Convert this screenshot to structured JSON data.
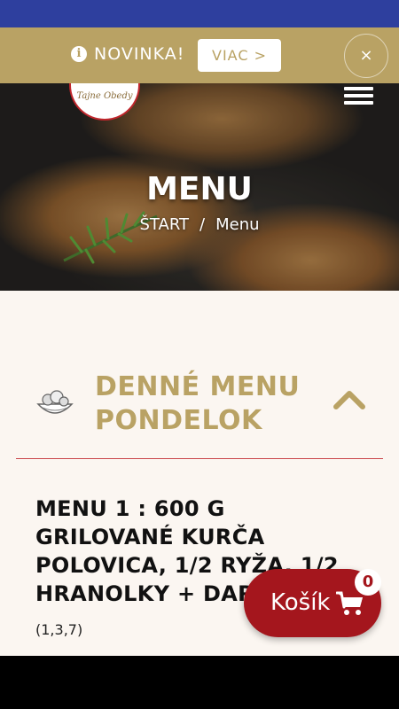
{
  "promo": {
    "info_icon": "info-icon",
    "info_glyph": "i",
    "text": "NOVINKA!",
    "button_label": "VIAC",
    "button_chevron": ">",
    "close_glyph": "×"
  },
  "header": {
    "logo_text": "Tajne Obedy",
    "menu_icon": "hamburger-icon"
  },
  "hero": {
    "title": "MENU",
    "breadcrumb": {
      "home": "ŠTART",
      "separator": "/",
      "current": "Menu"
    }
  },
  "accordion": {
    "icon": "food-bowl-icon",
    "title_line1": "DENNÉ MENU",
    "title_line2": "PONDELOK",
    "toggle_icon": "chevron-up-icon"
  },
  "menu_items": [
    {
      "title": "MENU 1 : 600 G GRILOVANÉ KURČA POLOVICA, 1/2 RYŽA, 1/2 HRANOLKY + DARČEK",
      "allergens": "(1,3,7)"
    }
  ],
  "cart": {
    "label": "Košík",
    "icon": "cart-icon",
    "count": "0"
  },
  "colors": {
    "status_strip": "#2e3f9e",
    "gold": "#b9a264",
    "cart_red": "#a4161d",
    "divider": "#c9454b",
    "content_bg": "#fbf6f1"
  }
}
